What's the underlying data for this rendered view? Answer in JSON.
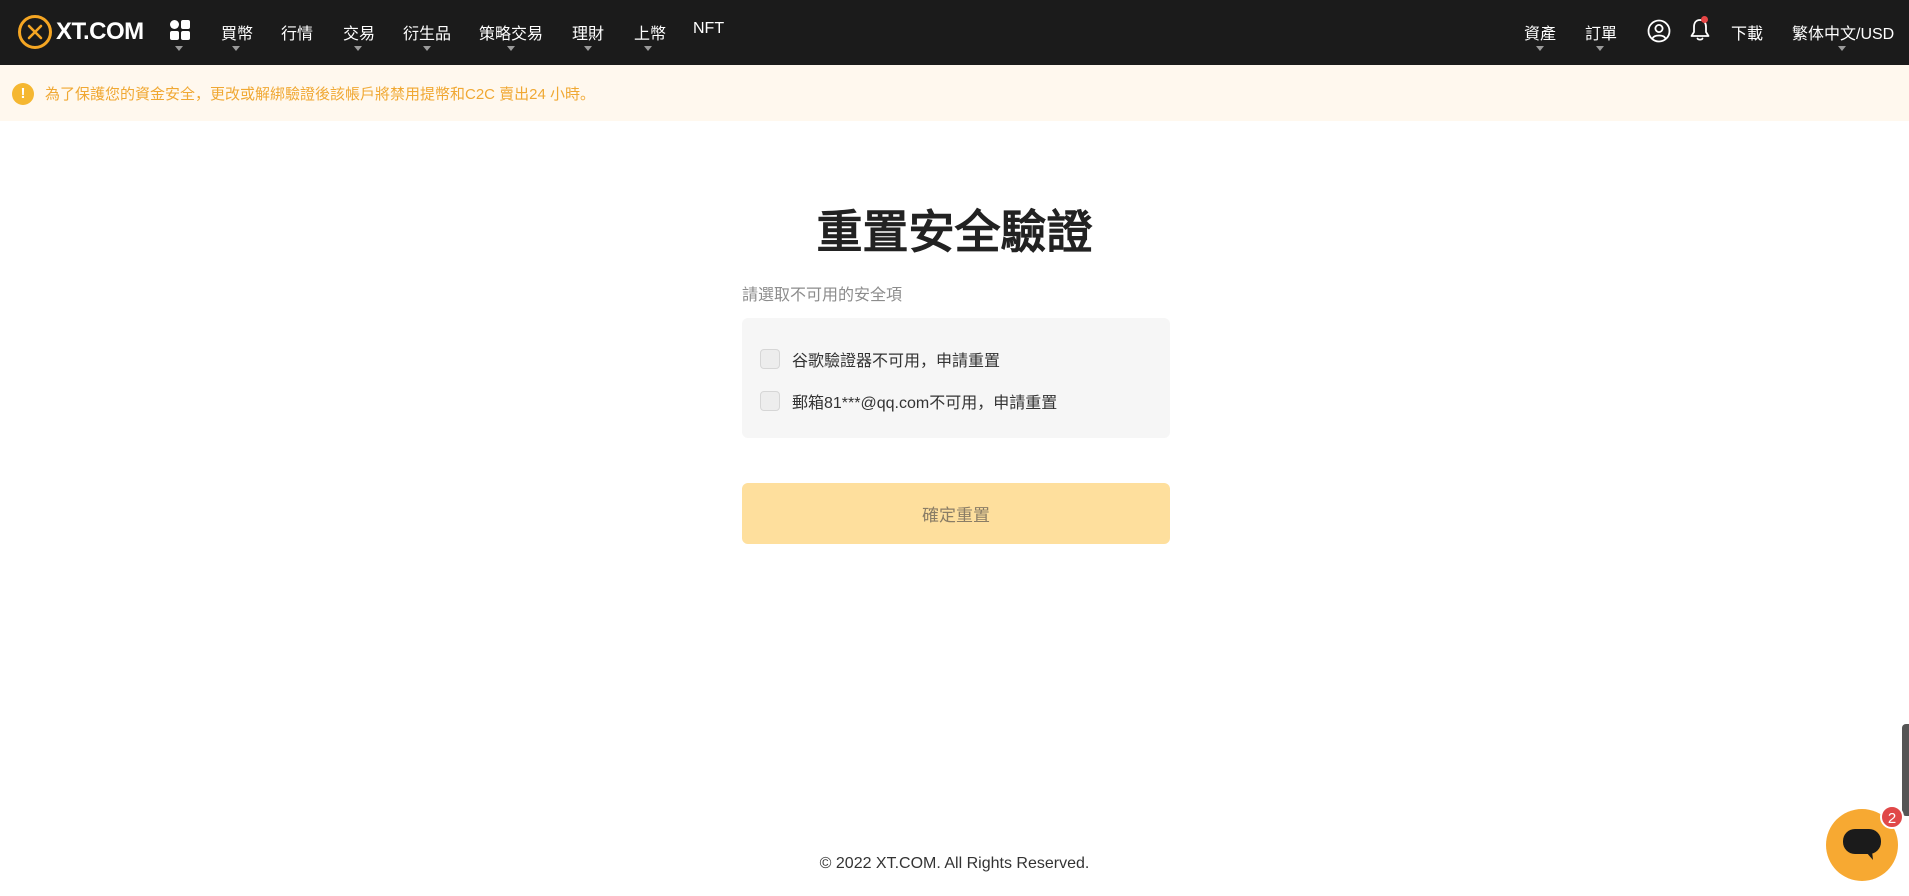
{
  "brand": {
    "logo_text": "XT.COM"
  },
  "nav": {
    "items": [
      {
        "label": "買幣",
        "has_caret": true
      },
      {
        "label": "行情",
        "has_caret": false
      },
      {
        "label": "交易",
        "has_caret": true
      },
      {
        "label": "衍生品",
        "has_caret": true
      },
      {
        "label": "策略交易",
        "has_caret": true
      },
      {
        "label": "理財",
        "has_caret": true
      },
      {
        "label": "上幣",
        "has_caret": true
      },
      {
        "label": "NFT",
        "has_caret": false
      }
    ],
    "right": {
      "assets": "資產",
      "orders": "訂單",
      "download": "下載",
      "language": "繁体中文/USD"
    }
  },
  "banner": {
    "icon": "!",
    "text": "為了保護您的資金安全，更改或解綁驗證後該帳戶將禁用提幣和C2C 賣出24 小時。"
  },
  "main": {
    "title": "重置安全驗證",
    "subtitle": "請選取不可用的安全項",
    "options": [
      {
        "label": "谷歌驗證器不可用，申請重置",
        "checked": false
      },
      {
        "label": "郵箱81***@qq.com不可用，申請重置",
        "checked": false
      }
    ],
    "confirm_label": "確定重置"
  },
  "footer": {
    "copyright": "© 2022 XT.COM. All Rights Reserved."
  },
  "chat": {
    "badge_count": "2"
  },
  "colors": {
    "accent": "#f7a932",
    "topbar": "#1b1b1b",
    "banner_bg": "#fff8ee",
    "banner_text": "#f0a833",
    "button_disabled": "#fedf9d"
  }
}
